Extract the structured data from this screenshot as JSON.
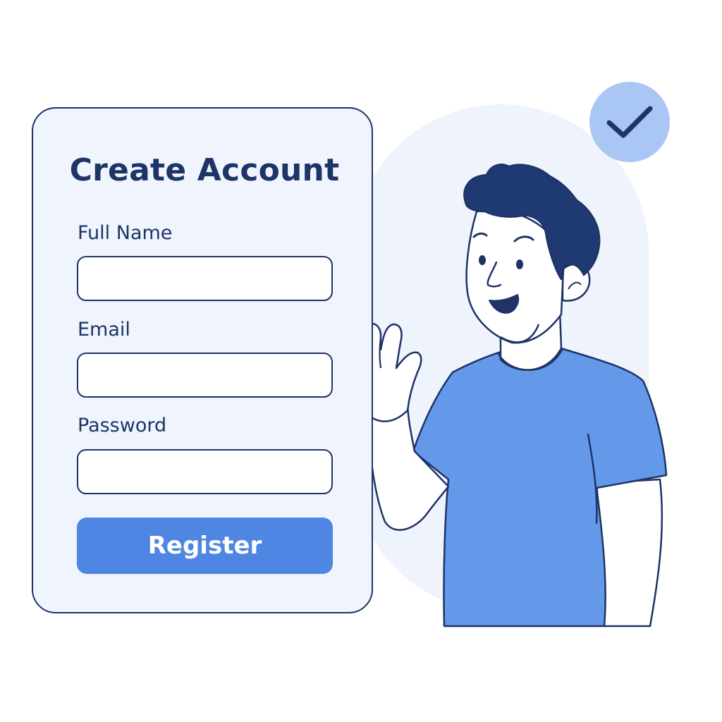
{
  "form": {
    "title": "Create Account",
    "fields": [
      {
        "label": "Full Name",
        "value": "",
        "placeholder": ""
      },
      {
        "label": "Email",
        "value": "",
        "placeholder": ""
      },
      {
        "label": "Password",
        "value": "",
        "placeholder": ""
      }
    ],
    "submit_label": "Register"
  },
  "illustration": {
    "badge_icon": "checkmark-icon",
    "character": "waving-person"
  },
  "colors": {
    "accent": "#4f86e3",
    "outline": "#1f3366",
    "card_background": "#eff4fd",
    "badge": "#a9c6f5",
    "shirt": "#6499ea",
    "hair": "#1f3a72"
  }
}
